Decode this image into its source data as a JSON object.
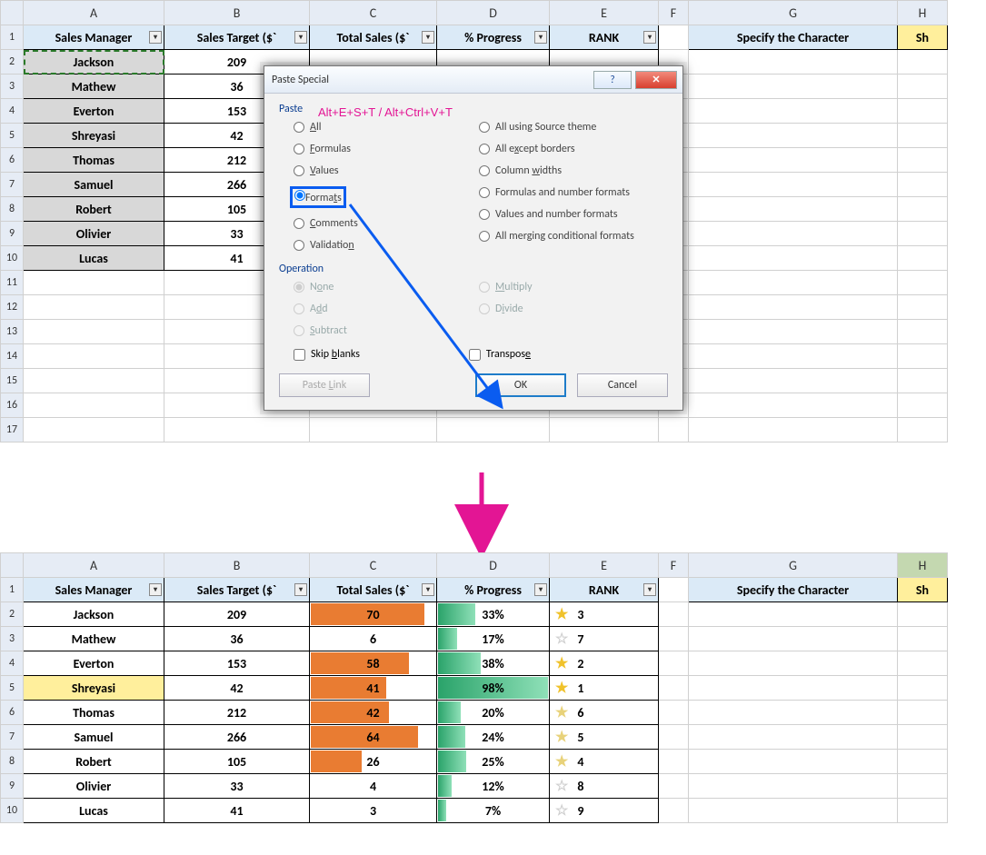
{
  "sheet1": {
    "columns": [
      "A",
      "B",
      "C",
      "D",
      "E",
      "F",
      "G",
      "H"
    ],
    "headers": {
      "A": "Sales Manager",
      "B": "Sales Target ($`",
      "C": "Total Sales ($`",
      "D": "% Progress",
      "E": "RANK",
      "G": "Specify the Character",
      "H": "Sh"
    },
    "rows": [
      "1",
      "2",
      "3",
      "4",
      "5",
      "6",
      "7",
      "8",
      "9",
      "10",
      "11",
      "12",
      "13",
      "14",
      "15",
      "16",
      "17"
    ],
    "data": [
      {
        "manager": "Jackson",
        "target": "209"
      },
      {
        "manager": "Mathew",
        "target": "36"
      },
      {
        "manager": "Everton",
        "target": "153"
      },
      {
        "manager": "Shreyasi",
        "target": "42"
      },
      {
        "manager": "Thomas",
        "target": "212"
      },
      {
        "manager": "Samuel",
        "target": "266"
      },
      {
        "manager": "Robert",
        "target": "105"
      },
      {
        "manager": "Olivier",
        "target": "33"
      },
      {
        "manager": "Lucas",
        "target": "41"
      }
    ]
  },
  "dialog": {
    "title": "Paste Special",
    "shortcut_anno": "Alt+E+S+T / Alt+Ctrl+V+T",
    "paste_label": "Paste",
    "options_left": [
      {
        "label": "All",
        "u": "A"
      },
      {
        "label": "Formulas",
        "u": "F"
      },
      {
        "label": "Values",
        "u": "V"
      },
      {
        "label": "Formats",
        "u": "T",
        "selected": true
      },
      {
        "label": "Comments",
        "u": "C"
      },
      {
        "label": "Validation",
        "u": "N"
      }
    ],
    "options_right": [
      {
        "label": "All using Source theme"
      },
      {
        "label": "All except borders",
        "u": "x"
      },
      {
        "label": "Column widths",
        "u": "w"
      },
      {
        "label": "Formulas and number formats"
      },
      {
        "label": "Values and number formats"
      },
      {
        "label": "All merging conditional formats"
      }
    ],
    "operation_label": "Operation",
    "op_left": [
      {
        "label": "None",
        "u": "O",
        "selected": true
      },
      {
        "label": "Add",
        "u": "D"
      },
      {
        "label": "Subtract",
        "u": "S"
      }
    ],
    "op_right": [
      {
        "label": "Multiply",
        "u": "M"
      },
      {
        "label": "Divide",
        "u": "I"
      }
    ],
    "skip_blanks": "Skip blanks",
    "transpose": "Transpose",
    "paste_link": "Paste Link",
    "ok": "OK",
    "cancel": "Cancel"
  },
  "sheet2": {
    "columns": [
      "A",
      "B",
      "C",
      "D",
      "E",
      "F",
      "G",
      "H"
    ],
    "headers": {
      "A": "Sales Manager",
      "B": "Sales Target ($`",
      "C": "Total Sales ($`",
      "D": "% Progress",
      "E": "RANK",
      "G": "Specify the Character",
      "H": "Sh"
    },
    "rows": [
      "1",
      "2",
      "3",
      "4",
      "5",
      "6",
      "7",
      "8",
      "9",
      "10"
    ],
    "data": [
      {
        "manager": "Jackson",
        "target": "209",
        "total": "70",
        "totalpct": 90,
        "progress": "33%",
        "progpct": 33,
        "rank": "3",
        "star": "full"
      },
      {
        "manager": "Mathew",
        "target": "36",
        "total": "6",
        "totalpct": 0,
        "progress": "17%",
        "progpct": 17,
        "rank": "7",
        "star": "dim"
      },
      {
        "manager": "Everton",
        "target": "153",
        "total": "58",
        "totalpct": 78,
        "progress": "38%",
        "progpct": 38,
        "rank": "2",
        "star": "full"
      },
      {
        "manager": "Shreyasi",
        "target": "42",
        "total": "41",
        "totalpct": 60,
        "progress": "98%",
        "progpct": 98,
        "rank": "1",
        "star": "full",
        "highlight": true
      },
      {
        "manager": "Thomas",
        "target": "212",
        "total": "42",
        "totalpct": 62,
        "progress": "20%",
        "progpct": 20,
        "rank": "6",
        "star": "half"
      },
      {
        "manager": "Samuel",
        "target": "266",
        "total": "64",
        "totalpct": 85,
        "progress": "24%",
        "progpct": 24,
        "rank": "5",
        "star": "half"
      },
      {
        "manager": "Robert",
        "target": "105",
        "total": "26",
        "totalpct": 40,
        "progress": "25%",
        "progpct": 25,
        "rank": "4",
        "star": "half"
      },
      {
        "manager": "Olivier",
        "target": "33",
        "total": "4",
        "totalpct": 0,
        "progress": "12%",
        "progpct": 12,
        "rank": "8",
        "star": "dim"
      },
      {
        "manager": "Lucas",
        "target": "41",
        "total": "3",
        "totalpct": 0,
        "progress": "7%",
        "progpct": 7,
        "rank": "9",
        "star": "dim"
      }
    ]
  },
  "chart_data": {
    "type": "table",
    "title": "Sales Progress with Conditional Formatting",
    "columns": [
      "Sales Manager",
      "Sales Target ($)",
      "Total Sales ($)",
      "% Progress",
      "RANK"
    ],
    "rows": [
      [
        "Jackson",
        209,
        70,
        "33%",
        3
      ],
      [
        "Mathew",
        36,
        6,
        "17%",
        7
      ],
      [
        "Everton",
        153,
        58,
        "38%",
        2
      ],
      [
        "Shreyasi",
        42,
        41,
        "98%",
        1
      ],
      [
        "Thomas",
        212,
        42,
        "20%",
        6
      ],
      [
        "Samuel",
        266,
        64,
        "24%",
        5
      ],
      [
        "Robert",
        105,
        26,
        "25%",
        4
      ],
      [
        "Olivier",
        33,
        4,
        "12%",
        8
      ],
      [
        "Lucas",
        41,
        3,
        "7%",
        9
      ]
    ]
  }
}
